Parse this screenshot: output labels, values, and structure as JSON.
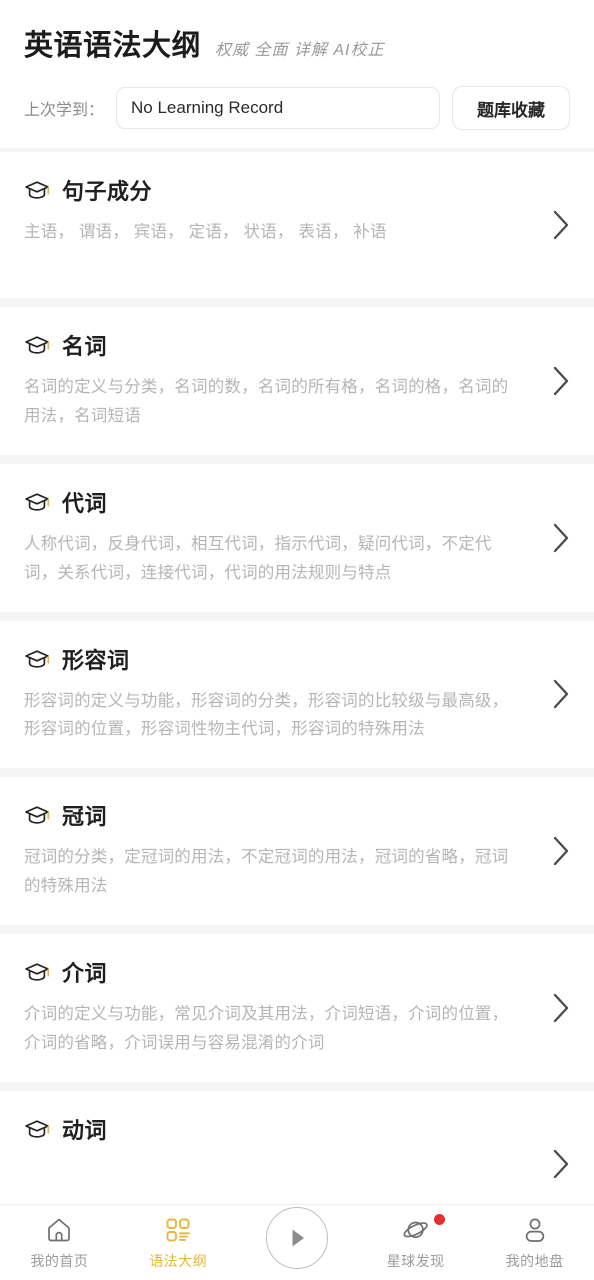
{
  "header": {
    "title": "英语语法大纲",
    "subtitle": "权威 全面 详解 AI校正",
    "record_label": "上次学到：",
    "record_value": "No Learning Record",
    "record_placeholder": "No Learning Record",
    "favorites_button": "题库收藏"
  },
  "colors": {
    "accent": "#e8b73a",
    "badge": "#e62e2e",
    "title": "#1c1c1c",
    "muted": "#b5b5b5",
    "page_bg": "#f5f5f5"
  },
  "list": {
    "items": [
      {
        "icon": "graduation-cap-icon",
        "title": "句子成分",
        "desc": "主语， 谓语， 宾语， 定语， 状语， 表语， 补语"
      },
      {
        "icon": "graduation-cap-icon",
        "title": "名词",
        "desc": "名词的定义与分类，名词的数，名词的所有格，名词的格，名词的用法，名词短语"
      },
      {
        "icon": "graduation-cap-icon",
        "title": "代词",
        "desc": "人称代词，反身代词，相互代词，指示代词，疑问代词，不定代词，关系代词，连接代词，代词的用法规则与特点"
      },
      {
        "icon": "graduation-cap-icon",
        "title": "形容词",
        "desc": "形容词的定义与功能，形容词的分类，形容词的比较级与最高级，形容词的位置，形容词性物主代词，形容词的特殊用法"
      },
      {
        "icon": "graduation-cap-icon",
        "title": "冠词",
        "desc": "冠词的分类，定冠词的用法，不定冠词的用法，冠词的省略，冠词的特殊用法"
      },
      {
        "icon": "graduation-cap-icon",
        "title": "介词",
        "desc": "介词的定义与功能，常见介词及其用法，介词短语，介词的位置，介词的省略，介词误用与容易混淆的介词"
      },
      {
        "icon": "graduation-cap-icon",
        "title": "动词",
        "desc": ""
      }
    ]
  },
  "tabbar": {
    "items": [
      {
        "icon": "home-icon",
        "label": "我的首页",
        "active": false,
        "badge": false
      },
      {
        "icon": "grid-outline-icon",
        "label": "语法大纲",
        "active": true,
        "badge": false
      },
      {
        "icon": "play-circle-icon",
        "label": "",
        "active": false,
        "badge": false
      },
      {
        "icon": "planet-icon",
        "label": "星球发现",
        "active": false,
        "badge": true
      },
      {
        "icon": "person-icon",
        "label": "我的地盘",
        "active": false,
        "badge": false
      }
    ]
  }
}
